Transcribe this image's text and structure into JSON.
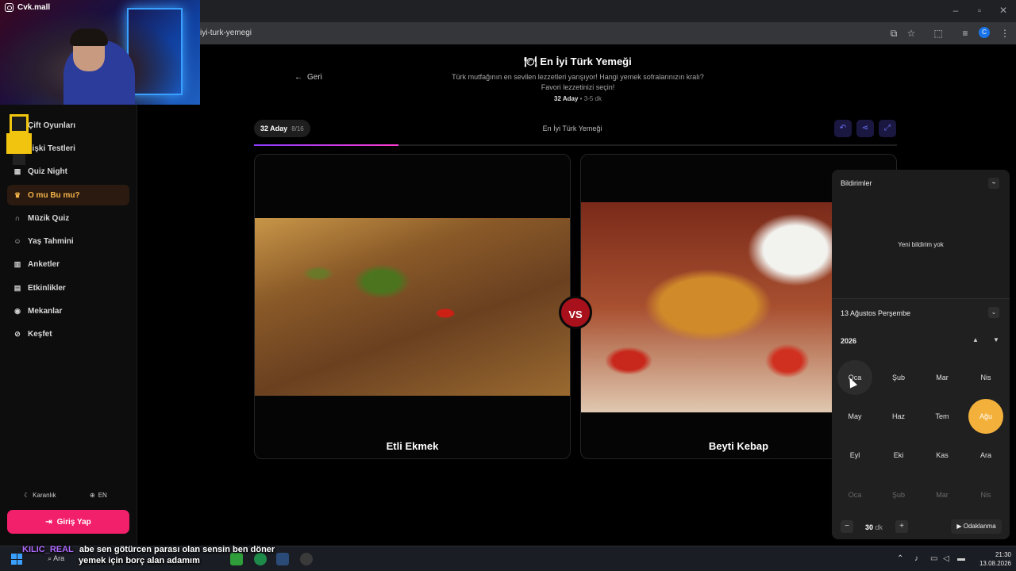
{
  "browser": {
    "url": "iyi-turk-yemegi"
  },
  "stream": {
    "channel": "Cvk.mall"
  },
  "sidebar": {
    "items": [
      {
        "label": "Çift Oyunları",
        "icon": "heart-icon"
      },
      {
        "label": "İlişki Testleri",
        "icon": "chart-icon"
      },
      {
        "label": "Quiz Night",
        "icon": "grid-icon"
      },
      {
        "label": "O mu Bu mu?",
        "icon": "trophy-icon",
        "active": true
      },
      {
        "label": "Müzik Quiz",
        "icon": "headphones-icon"
      },
      {
        "label": "Yaş Tahmini",
        "icon": "user-icon"
      },
      {
        "label": "Anketler",
        "icon": "bar-chart-icon"
      },
      {
        "label": "Etkinlikler",
        "icon": "calendar-icon"
      },
      {
        "label": "Mekanlar",
        "icon": "map-pin-icon"
      },
      {
        "label": "Keşfet",
        "icon": "compass-icon"
      }
    ],
    "theme_label": "Karanlık",
    "lang_label": "EN",
    "login_label": "Giriş Yap",
    "login_color": "#f21f6a",
    "active_color": "#f4b44a"
  },
  "header": {
    "back_label": "Geri",
    "title": "En İyi Türk Yemeği",
    "subtitle_1": "Türk mutfağının en sevilen lezzetleri yarışıyor! Hangi yemek sofralarınızın kralı?",
    "subtitle_2": "Favori lezzetinizi seçin!",
    "meta_count": "32 Aday",
    "meta_time": "3-5 dk"
  },
  "game": {
    "badge_count": "32 Aday",
    "round": "8/16",
    "title": "En İyi Türk Yemeği",
    "progress": 0.225,
    "vs_label": "VS",
    "options": [
      {
        "name": "Etli Ekmek"
      },
      {
        "name": "Beyti Kebap"
      }
    ]
  },
  "notifications": {
    "title": "Bildirimler",
    "empty": "Yeni bildirim yok"
  },
  "calendar": {
    "date_label": "13 Ağustos Perşembe",
    "year": "2026",
    "months": [
      {
        "label": "Oca",
        "state": "hover"
      },
      {
        "label": "Şub",
        "state": "normal"
      },
      {
        "label": "Mar",
        "state": "normal"
      },
      {
        "label": "Nis",
        "state": "normal"
      },
      {
        "label": "May",
        "state": "normal"
      },
      {
        "label": "Haz",
        "state": "normal"
      },
      {
        "label": "Tem",
        "state": "normal"
      },
      {
        "label": "Ağu",
        "state": "selected"
      },
      {
        "label": "Eyl",
        "state": "normal"
      },
      {
        "label": "Eki",
        "state": "normal"
      },
      {
        "label": "Kas",
        "state": "normal"
      },
      {
        "label": "Ara",
        "state": "normal"
      },
      {
        "label": "Oca",
        "state": "dim"
      },
      {
        "label": "Şub",
        "state": "dim"
      },
      {
        "label": "Mar",
        "state": "dim"
      },
      {
        "label": "Nis",
        "state": "dim"
      }
    ],
    "focus_value": "30",
    "focus_unit": "dk",
    "focus_label": "Odaklanma",
    "accent": "#f3b13c"
  },
  "chat": {
    "user": "KILIC_REAL",
    "line1": "abe sen götürcen parası olan sensin ben döner",
    "line2": "yemek için borç alan adamım"
  },
  "taskbar": {
    "search_label": "Ara",
    "time": "21:30",
    "date": "13.08.2026"
  }
}
